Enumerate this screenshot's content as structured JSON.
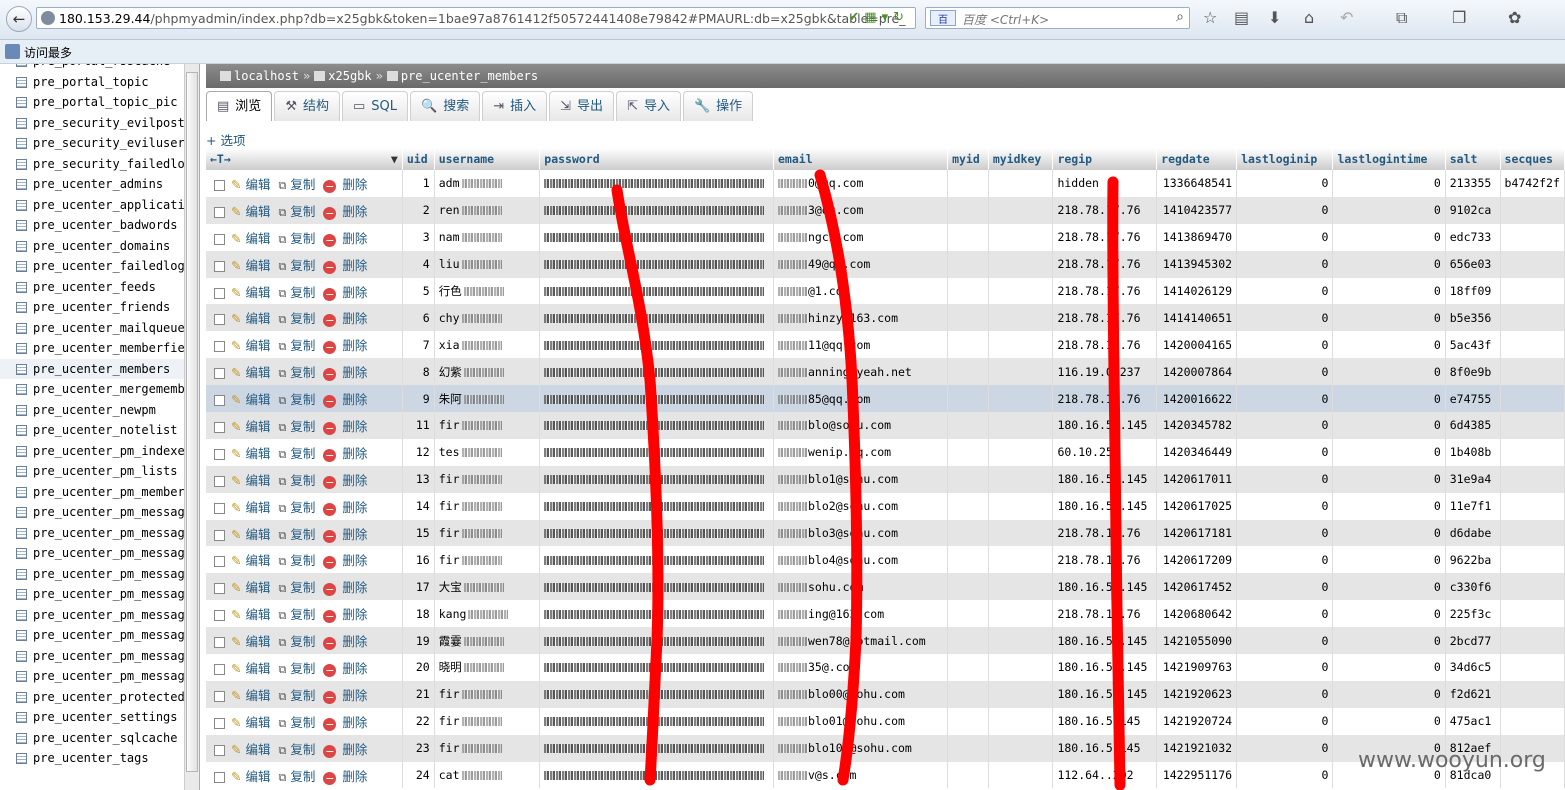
{
  "browser": {
    "url_host": "180.153.29.44",
    "url_rest": "/phpmyadmin/index.php?db=x25gbk&token=1bae97a8761412f50572441408e79842#PMAURL:db=x25gbk&table=pre_",
    "search_engine": "百",
    "search_placeholder": "百度 <Ctrl+K>",
    "bookmark_label": "访问最多"
  },
  "sidebar": {
    "tables": [
      "pre_portal_rsscache",
      "pre_portal_topic",
      "pre_portal_topic_pic",
      "pre_security_evilpost",
      "pre_security_eviluser",
      "pre_security_failedlog",
      "pre_ucenter_admins",
      "pre_ucenter_applications",
      "pre_ucenter_badwords",
      "pre_ucenter_domains",
      "pre_ucenter_failedlogins",
      "pre_ucenter_feeds",
      "pre_ucenter_friends",
      "pre_ucenter_mailqueue",
      "pre_ucenter_memberfields",
      "pre_ucenter_members",
      "pre_ucenter_mergemembers",
      "pre_ucenter_newpm",
      "pre_ucenter_notelist",
      "pre_ucenter_pm_indexes",
      "pre_ucenter_pm_lists",
      "pre_ucenter_pm_members",
      "pre_ucenter_pm_messages",
      "pre_ucenter_pm_messages",
      "pre_ucenter_pm_messages",
      "pre_ucenter_pm_messages",
      "pre_ucenter_pm_messages",
      "pre_ucenter_pm_messages",
      "pre_ucenter_pm_messages",
      "pre_ucenter_pm_messages",
      "pre_ucenter_pm_messages",
      "pre_ucenter_protectedmembers",
      "pre_ucenter_settings",
      "pre_ucenter_sqlcache",
      "pre_ucenter_tags"
    ],
    "active_index": 15
  },
  "breadcrumb": {
    "server": "localhost",
    "database": "x25gbk",
    "table": "pre_ucenter_members"
  },
  "tabs": [
    {
      "label": "浏览",
      "icon": "▤"
    },
    {
      "label": "结构",
      "icon": "⚒"
    },
    {
      "label": "SQL",
      "icon": "▭"
    },
    {
      "label": "搜索",
      "icon": "🔍"
    },
    {
      "label": "插入",
      "icon": "⇥"
    },
    {
      "label": "导出",
      "icon": "⇲"
    },
    {
      "label": "导入",
      "icon": "⇱"
    },
    {
      "label": "操作",
      "icon": "🔧"
    }
  ],
  "options_label": "+ 选项",
  "table": {
    "nav_arrows": "←T→",
    "columns": [
      "uid",
      "username",
      "password",
      "email",
      "myid",
      "myidkey",
      "regip",
      "regdate",
      "lastloginip",
      "lastlogintime",
      "salt",
      "secques"
    ],
    "actions": {
      "edit": "编辑",
      "copy": "复制",
      "delete": "删除"
    },
    "rows": [
      {
        "uid": "1",
        "username": "adm",
        "email": "0@qq.com",
        "regip": "hidden",
        "regdate": "1336648541",
        "lastloginip": "0",
        "lastlogintime": "0",
        "salt": "213355",
        "secques": "b4742f2f"
      },
      {
        "uid": "2",
        "username": "ren",
        "email": "3@qq.com",
        "regip": "218.78.17.76",
        "regdate": "1410423577",
        "lastloginip": "0",
        "lastlogintime": "0",
        "salt": "9102ca",
        "secques": ""
      },
      {
        "uid": "3",
        "username": "nam",
        "email": "ngch.com",
        "regip": "218.78.17.76",
        "regdate": "1413869470",
        "lastloginip": "0",
        "lastlogintime": "0",
        "salt": "edc733",
        "secques": ""
      },
      {
        "uid": "4",
        "username": "liu",
        "email": "49@qq.com",
        "regip": "218.78.17.76",
        "regdate": "1413945302",
        "lastloginip": "0",
        "lastlogintime": "0",
        "salt": "656e03",
        "secques": ""
      },
      {
        "uid": "5",
        "username": "行色",
        "email": "@1.com",
        "regip": "218.78.17.76",
        "regdate": "1414026129",
        "lastloginip": "0",
        "lastlogintime": "0",
        "salt": "18ff09",
        "secques": ""
      },
      {
        "uid": "6",
        "username": "chy",
        "email": "hinzy@163.com",
        "regip": "218.78.17.76",
        "regdate": "1414140651",
        "lastloginip": "0",
        "lastlogintime": "0",
        "salt": "b5e356",
        "secques": ""
      },
      {
        "uid": "7",
        "username": "xia",
        "email": "11@qq.com",
        "regip": "218.78.17.76",
        "regdate": "1420004165",
        "lastloginip": "0",
        "lastlogintime": "0",
        "salt": "5ac43f",
        "secques": ""
      },
      {
        "uid": "8",
        "username": "幻紫",
        "email": "anning@yeah.net",
        "regip": "116.19.0.237",
        "regdate": "1420007864",
        "lastloginip": "0",
        "lastlogintime": "0",
        "salt": "8f0e9b",
        "secques": ""
      },
      {
        "uid": "9",
        "username": "朱阿",
        "email": "85@qq.com",
        "regip": "218.78.17.76",
        "regdate": "1420016622",
        "lastloginip": "0",
        "lastlogintime": "0",
        "salt": "e74755",
        "secques": ""
      },
      {
        "uid": "11",
        "username": "fir",
        "email": "blo@sohu.com",
        "regip": "180.16.55.145",
        "regdate": "1420345782",
        "lastloginip": "0",
        "lastlogintime": "0",
        "salt": "6d4385",
        "secques": ""
      },
      {
        "uid": "12",
        "username": "tes",
        "email": "wenip.qq.com",
        "regip": "60.10.25",
        "regdate": "1420346449",
        "lastloginip": "0",
        "lastlogintime": "0",
        "salt": "1b408b",
        "secques": ""
      },
      {
        "uid": "13",
        "username": "fir",
        "email": "blo1@sohu.com",
        "regip": "180.16.55.145",
        "regdate": "1420617011",
        "lastloginip": "0",
        "lastlogintime": "0",
        "salt": "31e9a4",
        "secques": ""
      },
      {
        "uid": "14",
        "username": "fir",
        "email": "blo2@sohu.com",
        "regip": "180.16.55.145",
        "regdate": "1420617025",
        "lastloginip": "0",
        "lastlogintime": "0",
        "salt": "11e7f1",
        "secques": ""
      },
      {
        "uid": "15",
        "username": "fir",
        "email": "blo3@sohu.com",
        "regip": "218.78.17.76",
        "regdate": "1420617181",
        "lastloginip": "0",
        "lastlogintime": "0",
        "salt": "d6dabe",
        "secques": ""
      },
      {
        "uid": "16",
        "username": "fir",
        "email": "blo4@sohu.com",
        "regip": "218.78.17.76",
        "regdate": "1420617209",
        "lastloginip": "0",
        "lastlogintime": "0",
        "salt": "9622ba",
        "secques": ""
      },
      {
        "uid": "17",
        "username": "大宝",
        "email": "sohu.com",
        "regip": "180.16.55.145",
        "regdate": "1420617452",
        "lastloginip": "0",
        "lastlogintime": "0",
        "salt": "c330f6",
        "secques": ""
      },
      {
        "uid": "18",
        "username": "kang",
        "email": "ing@163.com",
        "regip": "218.78.17.76",
        "regdate": "1420680642",
        "lastloginip": "0",
        "lastlogintime": "0",
        "salt": "225f3c",
        "secques": ""
      },
      {
        "uid": "19",
        "username": "霞霎",
        "email": "wen78@hotmail.com",
        "regip": "180.16.55.145",
        "regdate": "1421055090",
        "lastloginip": "0",
        "lastlogintime": "0",
        "salt": "2bcd77",
        "secques": ""
      },
      {
        "uid": "20",
        "username": "晓明",
        "email": "35@.com",
        "regip": "180.16.55.145",
        "regdate": "1421909763",
        "lastloginip": "0",
        "lastlogintime": "0",
        "salt": "34d6c5",
        "secques": ""
      },
      {
        "uid": "21",
        "username": "fir",
        "email": "blo00@sohu.com",
        "regip": "180.16.55.145",
        "regdate": "1421920623",
        "lastloginip": "0",
        "lastlogintime": "0",
        "salt": "f2d621",
        "secques": ""
      },
      {
        "uid": "22",
        "username": "fir",
        "email": "blo01@sohu.com",
        "regip": "180.16.5.145",
        "regdate": "1421920724",
        "lastloginip": "0",
        "lastlogintime": "0",
        "salt": "475ac1",
        "secques": ""
      },
      {
        "uid": "23",
        "username": "fir",
        "email": "blo102@sohu.com",
        "regip": "180.16.5.145",
        "regdate": "1421921032",
        "lastloginip": "0",
        "lastlogintime": "0",
        "salt": "812aef",
        "secques": ""
      },
      {
        "uid": "24",
        "username": "cat",
        "email": "v@s.com",
        "regip": "112.64..202",
        "regdate": "1422951176",
        "lastloginip": "0",
        "lastlogintime": "0",
        "salt": "81dca0",
        "secques": ""
      }
    ],
    "marked_row_index": 8
  },
  "annotation_color": "#ff0000",
  "watermark": "www.wooyun.org"
}
